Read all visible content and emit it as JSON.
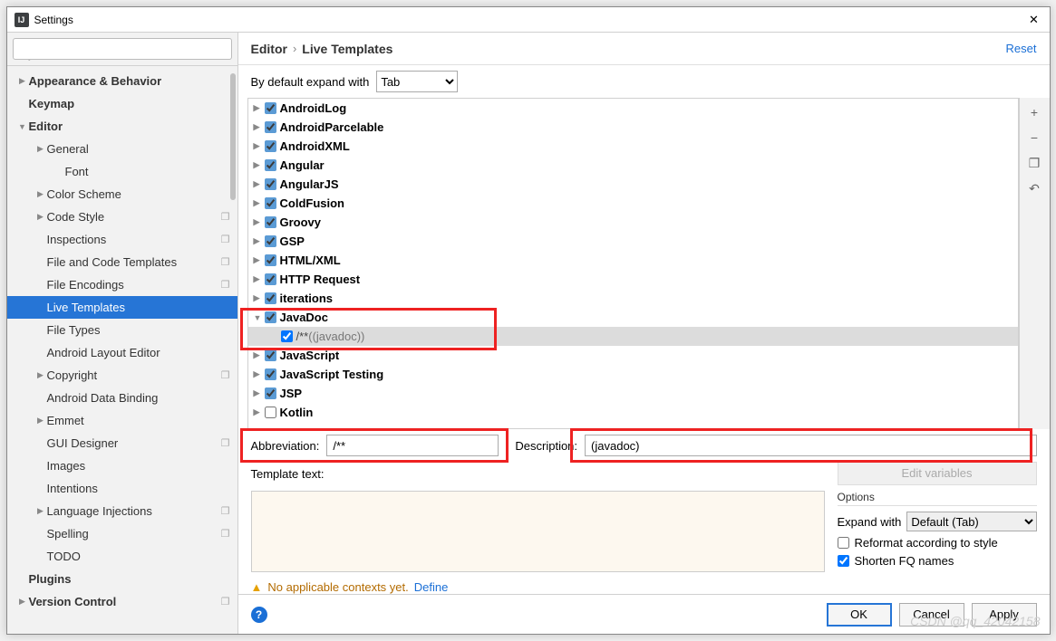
{
  "window": {
    "title": "Settings"
  },
  "search": {
    "placeholder": "",
    "prefix": "Q"
  },
  "sidebar": [
    {
      "label": "Appearance & Behavior",
      "depth": 0,
      "arrow": "▶",
      "bold": true
    },
    {
      "label": "Keymap",
      "depth": 0,
      "arrow": "",
      "bold": true
    },
    {
      "label": "Editor",
      "depth": 0,
      "arrow": "▼",
      "bold": true
    },
    {
      "label": "General",
      "depth": 1,
      "arrow": "▶"
    },
    {
      "label": "Font",
      "depth": 2,
      "arrow": ""
    },
    {
      "label": "Color Scheme",
      "depth": 1,
      "arrow": "▶"
    },
    {
      "label": "Code Style",
      "depth": 1,
      "arrow": "▶",
      "copy": true
    },
    {
      "label": "Inspections",
      "depth": 1,
      "arrow": "",
      "copy": true
    },
    {
      "label": "File and Code Templates",
      "depth": 1,
      "arrow": "",
      "copy": true
    },
    {
      "label": "File Encodings",
      "depth": 1,
      "arrow": "",
      "copy": true
    },
    {
      "label": "Live Templates",
      "depth": 1,
      "arrow": "",
      "sel": true
    },
    {
      "label": "File Types",
      "depth": 1,
      "arrow": ""
    },
    {
      "label": "Android Layout Editor",
      "depth": 1,
      "arrow": ""
    },
    {
      "label": "Copyright",
      "depth": 1,
      "arrow": "▶",
      "copy": true
    },
    {
      "label": "Android Data Binding",
      "depth": 1,
      "arrow": ""
    },
    {
      "label": "Emmet",
      "depth": 1,
      "arrow": "▶"
    },
    {
      "label": "GUI Designer",
      "depth": 1,
      "arrow": "",
      "copy": true
    },
    {
      "label": "Images",
      "depth": 1,
      "arrow": ""
    },
    {
      "label": "Intentions",
      "depth": 1,
      "arrow": ""
    },
    {
      "label": "Language Injections",
      "depth": 1,
      "arrow": "▶",
      "copy": true
    },
    {
      "label": "Spelling",
      "depth": 1,
      "arrow": "",
      "copy": true
    },
    {
      "label": "TODO",
      "depth": 1,
      "arrow": ""
    },
    {
      "label": "Plugins",
      "depth": 0,
      "arrow": "",
      "bold": true
    },
    {
      "label": "Version Control",
      "depth": 0,
      "arrow": "▶",
      "bold": true,
      "copy": true
    }
  ],
  "breadcrumb": {
    "a": "Editor",
    "b": "Live Templates",
    "reset": "Reset"
  },
  "expand": {
    "label": "By default expand with",
    "value": "Tab"
  },
  "templates": [
    {
      "label": "AndroidLog",
      "arrow": "▶",
      "checked": true
    },
    {
      "label": "AndroidParcelable",
      "arrow": "▶",
      "checked": true
    },
    {
      "label": "AndroidXML",
      "arrow": "▶",
      "checked": true
    },
    {
      "label": "Angular",
      "arrow": "▶",
      "checked": true
    },
    {
      "label": "AngularJS",
      "arrow": "▶",
      "checked": true
    },
    {
      "label": "ColdFusion",
      "arrow": "▶",
      "checked": true
    },
    {
      "label": "Groovy",
      "arrow": "▶",
      "checked": true
    },
    {
      "label": "GSP",
      "arrow": "▶",
      "checked": true
    },
    {
      "label": "HTML/XML",
      "arrow": "▶",
      "checked": true
    },
    {
      "label": "HTTP Request",
      "arrow": "▶",
      "checked": true
    },
    {
      "label": "iterations",
      "arrow": "▶",
      "checked": true
    },
    {
      "label": "JavaDoc",
      "arrow": "▼",
      "checked": true,
      "expanded": true,
      "child": {
        "abbr": "/**",
        "desc": "((javadoc))",
        "checked": true
      }
    },
    {
      "label": "JavaScript",
      "arrow": "▶",
      "checked": true
    },
    {
      "label": "JavaScript Testing",
      "arrow": "▶",
      "checked": true
    },
    {
      "label": "JSP",
      "arrow": "▶",
      "checked": true
    },
    {
      "label": "Kotlin",
      "arrow": "▶",
      "checked": false
    }
  ],
  "form": {
    "abbr_label": "Abbreviation:",
    "abbr_value": "/**",
    "desc_label": "Description:",
    "desc_value": "(javadoc)",
    "edit_vars": "Edit variables",
    "tmpl_label": "Template text:"
  },
  "options": {
    "title": "Options",
    "expand_label": "Expand with",
    "expand_value": "Default (Tab)",
    "reformat": {
      "label": "Reformat according to style",
      "checked": false
    },
    "shorten": {
      "label": "Shorten FQ names",
      "checked": true
    }
  },
  "warn": {
    "text": "No applicable contexts yet.",
    "define": "Define"
  },
  "buttons": {
    "ok": "OK",
    "cancel": "Cancel",
    "apply": "Apply"
  },
  "watermark": "CSDN @qq_42042158",
  "side_actions": [
    "+",
    "−",
    "❐",
    "↶"
  ]
}
